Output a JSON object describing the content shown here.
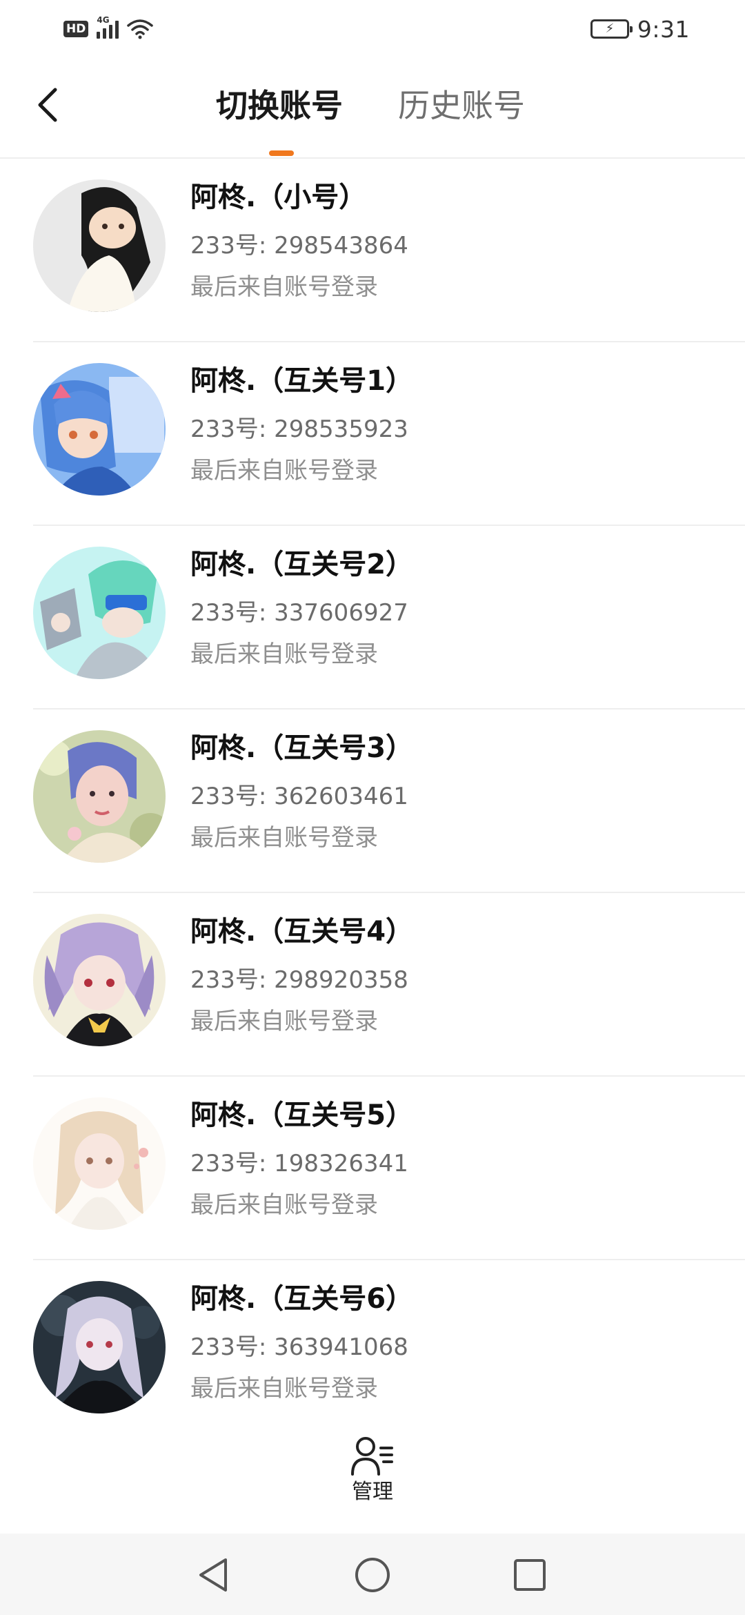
{
  "status_bar": {
    "hd_label": "HD",
    "network_label": "4G",
    "time": "9:31"
  },
  "header": {
    "tabs": [
      {
        "label": "切换账号",
        "active": true
      },
      {
        "label": "历史账号",
        "active": false
      }
    ],
    "accent_color": "#f0781e"
  },
  "accounts": [
    {
      "name": "阿柊.（小号）",
      "id_text": "233号: 298543864",
      "login_text": "最后来自账号登录",
      "avatar_colors": [
        "#e8e8e8",
        "#1b1b1b",
        "#f4d9c2"
      ]
    },
    {
      "name": "阿柊.（互关号1）",
      "id_text": "233号: 298535923",
      "login_text": "最后来自账号登录",
      "avatar_colors": [
        "#7fb2f0",
        "#4e7fd8",
        "#f6d7c6"
      ]
    },
    {
      "name": "阿柊.（互关号2）",
      "id_text": "233号: 337606927",
      "login_text": "最后来自账号登录",
      "avatar_colors": [
        "#bff2f0",
        "#62d4b8",
        "#9aa8b4"
      ]
    },
    {
      "name": "阿柊.（互关号3）",
      "id_text": "233号: 362603461",
      "login_text": "最后来自账号登录",
      "avatar_colors": [
        "#c9d4a8",
        "#6d7bc9",
        "#f1cdc6"
      ]
    },
    {
      "name": "阿柊.（互关号4）",
      "id_text": "233号: 298920358",
      "login_text": "最后来自账号登录",
      "avatar_colors": [
        "#f3efe0",
        "#b9a6d6",
        "#1a1a1a"
      ]
    },
    {
      "name": "阿柊.（互关号5）",
      "id_text": "233号: 198326341",
      "login_text": "最后来自账号登录",
      "avatar_colors": [
        "#fbf6f0",
        "#ead7c0",
        "#f2c9c6"
      ]
    },
    {
      "name": "阿柊.（互关号6）",
      "id_text": "233号: 363941068",
      "login_text": "最后来自账号登录",
      "avatar_colors": [
        "#2a3540",
        "#c9c6dc",
        "#121418"
      ]
    }
  ],
  "manage": {
    "label": "管理",
    "icon": "user-manage-icon"
  },
  "nav_bar": {
    "icons": [
      "back-triangle-icon",
      "home-circle-icon",
      "recents-square-icon"
    ]
  }
}
